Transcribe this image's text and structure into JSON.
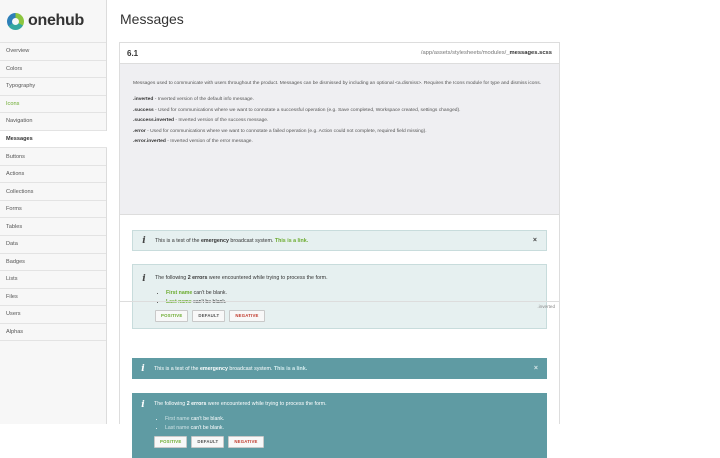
{
  "brand": {
    "name": "onehub"
  },
  "sidebar": {
    "items": [
      {
        "label": "Overview"
      },
      {
        "label": "Colors"
      },
      {
        "label": "Typography"
      },
      {
        "label": "Icons"
      },
      {
        "label": "Navigation"
      },
      {
        "label": "Messages"
      },
      {
        "label": "Buttons"
      },
      {
        "label": "Actions"
      },
      {
        "label": "Collections"
      },
      {
        "label": "Forms"
      },
      {
        "label": "Tables"
      },
      {
        "label": "Data"
      },
      {
        "label": "Badges"
      },
      {
        "label": "Lists"
      },
      {
        "label": "Files"
      },
      {
        "label": "Users"
      },
      {
        "label": "Alphas"
      }
    ],
    "active": "Messages",
    "highlighted": "Icons"
  },
  "page": {
    "title": "Messages"
  },
  "section": {
    "number": "6.1",
    "path_prefix": "/app/assets/stylesheets/modules/",
    "path_file": "_messages.scss",
    "description": "Messages used to communicate with users throughout the product. Messages can be dismissed by including an optional <a.dismiss>. Requires the Icons module for type and dismiss icons.",
    "modifiers": [
      {
        "name": ".inverted",
        "text": " - Inverted version of the default info message."
      },
      {
        "name": ".success",
        "text": " - Used for communications where we want to connotate a successful operation (e.g. Save completed, Workspace created, settings changed)."
      },
      {
        "name": ".success.inverted",
        "text": " - Inverted version of the success message."
      },
      {
        "name": ".error",
        "text": " - Used for communications where we want to connotate a failed operation (e.g. Action could not complete, required field missing)."
      },
      {
        "name": ".error.inverted",
        "text": " - Inverted version of the error message."
      }
    ]
  },
  "examples": {
    "inverted_tag": ".inverted",
    "info_icon": "i",
    "close_icon": "×",
    "broadcast": {
      "pre": "This is a test of the ",
      "strong": "emergency",
      "mid": " broadcast system. ",
      "link": "This is a link."
    },
    "errors": {
      "pre": "The following ",
      "strong": "2 errors",
      "post": " were encountered while trying to process the form.",
      "items": [
        {
          "field": "First name",
          "text": " can't be blank."
        },
        {
          "field": "Last name",
          "text": " can't be blank."
        }
      ]
    },
    "buttons": {
      "positive": "POSITIVE",
      "default": "DEFAULT",
      "negative": "NEGATIVE"
    }
  },
  "colors": {
    "accent_green": "#6bab2e",
    "inverted_bg": "#5f9ba3",
    "light_bg": "#e6f0f0",
    "negative_red": "#c0392b"
  }
}
